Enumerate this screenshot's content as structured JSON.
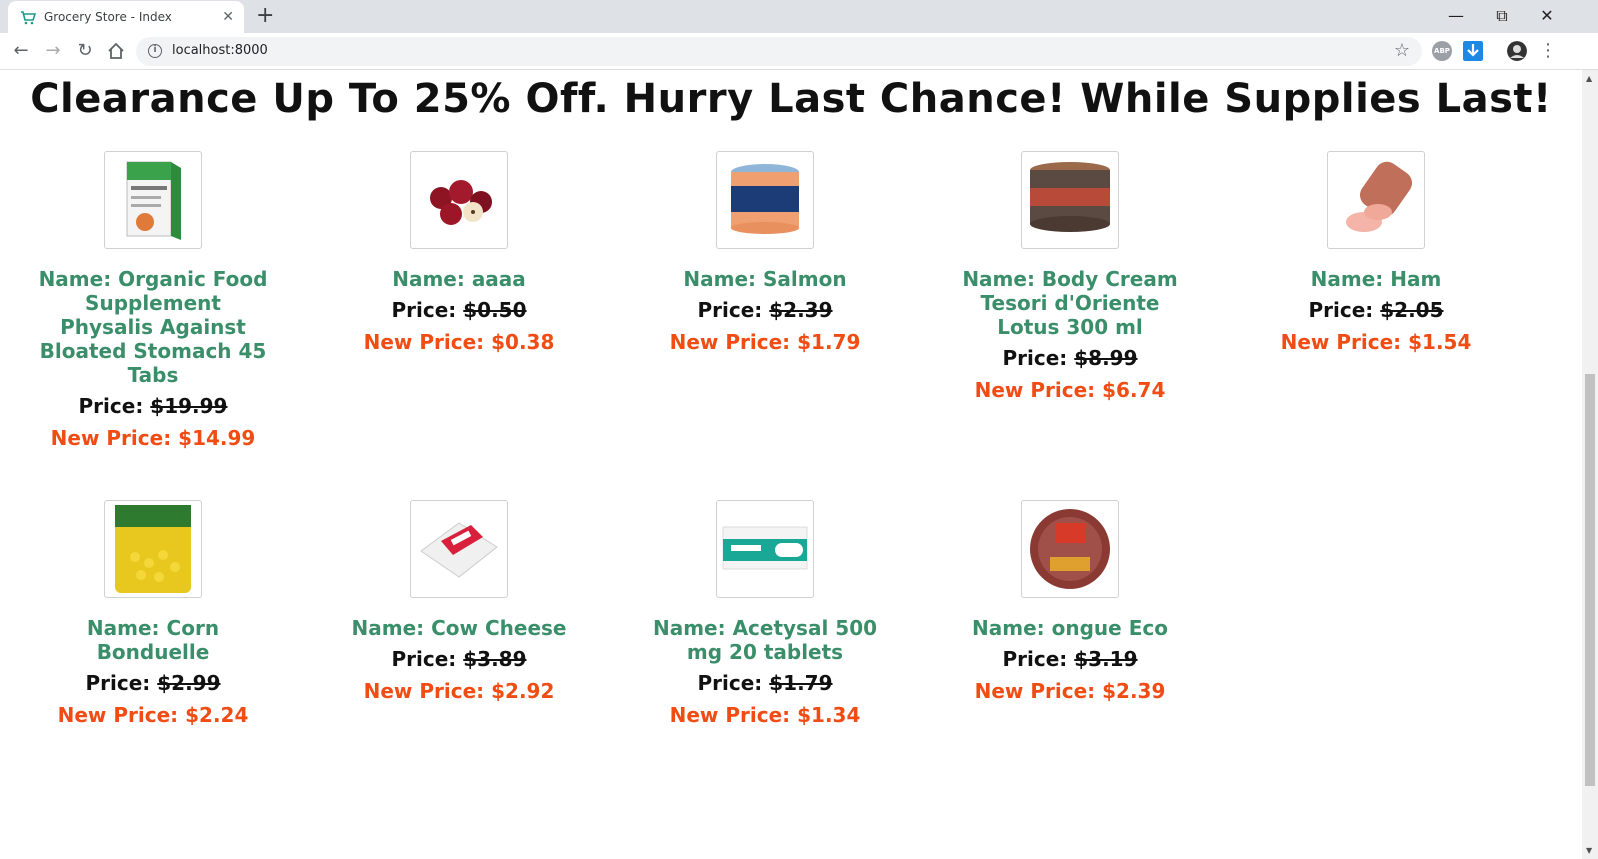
{
  "browser": {
    "tab_title": "Grocery Store - Index",
    "url": "localhost:8000",
    "new_tab_symbol": "+",
    "close_symbol": "✕"
  },
  "page": {
    "headline": "Clearance Up To 25% Off. Hurry Last Chance! While Supplies Last!",
    "name_prefix": "Name: ",
    "price_prefix": "Price: ",
    "new_price_prefix": "New Price: "
  },
  "products": [
    {
      "name": "Organic Food Supplement Physalis Against Bloated Stomach 45 Tabs",
      "price": "$19.99",
      "new_price": "$14.99",
      "image_icon": "supplement-box-image"
    },
    {
      "name": "aaaa",
      "price": "$0.50",
      "new_price": "$0.38",
      "image_icon": "apples-image"
    },
    {
      "name": "Salmon",
      "price": "$2.39",
      "new_price": "$1.79",
      "image_icon": "salmon-jar-image"
    },
    {
      "name": "Body Cream Tesori d'Oriente Lotus 300 ml",
      "price": "$8.99",
      "new_price": "$6.74",
      "image_icon": "cream-jar-image"
    },
    {
      "name": "Ham",
      "price": "$2.05",
      "new_price": "$1.54",
      "image_icon": "ham-image"
    },
    {
      "name": "Corn Bonduelle",
      "price": "$2.99",
      "new_price": "$2.24",
      "image_icon": "corn-bag-image"
    },
    {
      "name": "Cow Cheese",
      "price": "$3.89",
      "new_price": "$2.92",
      "image_icon": "cheese-pack-image"
    },
    {
      "name": "Acetysal 500 mg 20 tablets",
      "price": "$1.79",
      "new_price": "$1.34",
      "image_icon": "tablet-box-image"
    },
    {
      "name": "ongue Eco",
      "price": "$3.19",
      "new_price": "$2.39",
      "image_icon": "tongue-meat-image"
    }
  ],
  "colors": {
    "name_color": "#3a8f6a",
    "new_price_color": "#f04c14",
    "tab_bar": "#dee1e6"
  }
}
